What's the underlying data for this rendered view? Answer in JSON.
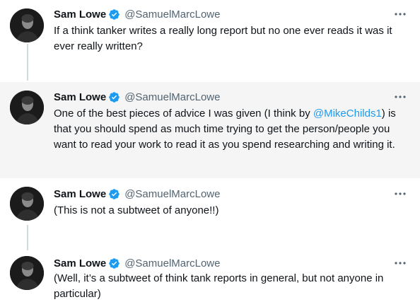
{
  "tweets": [
    {
      "author_name": "Sam Lowe",
      "handle": "@SamuelMarcLowe",
      "text": "If a think tanker writes a really long report but no one ever reads it was it ever really written?"
    },
    {
      "author_name": "Sam Lowe",
      "handle": "@SamuelMarcLowe",
      "text_before": "One of the best pieces of advice I was given (I think by ",
      "mention": "@MikeChilds1",
      "text_after": ") is that you should spend as much time trying to get the person/people you want to read your work to read it as you spend researching and writing it."
    },
    {
      "author_name": "Sam Lowe",
      "handle": "@SamuelMarcLowe",
      "text": "(This is not a subtweet of anyone!!)"
    },
    {
      "author_name": "Sam Lowe",
      "handle": "@SamuelMarcLowe",
      "text": "(Well, it’s a subtweet of think tank reports in general, but not anyone in particular)"
    }
  ],
  "colors": {
    "accent": "#1d9bf0",
    "secondary_text": "#536471",
    "highlight_bg": "#f5f5f5",
    "thread_line": "#cfd9de"
  },
  "icons": {
    "verified": "verified-badge-icon",
    "more": "more-options-icon"
  }
}
